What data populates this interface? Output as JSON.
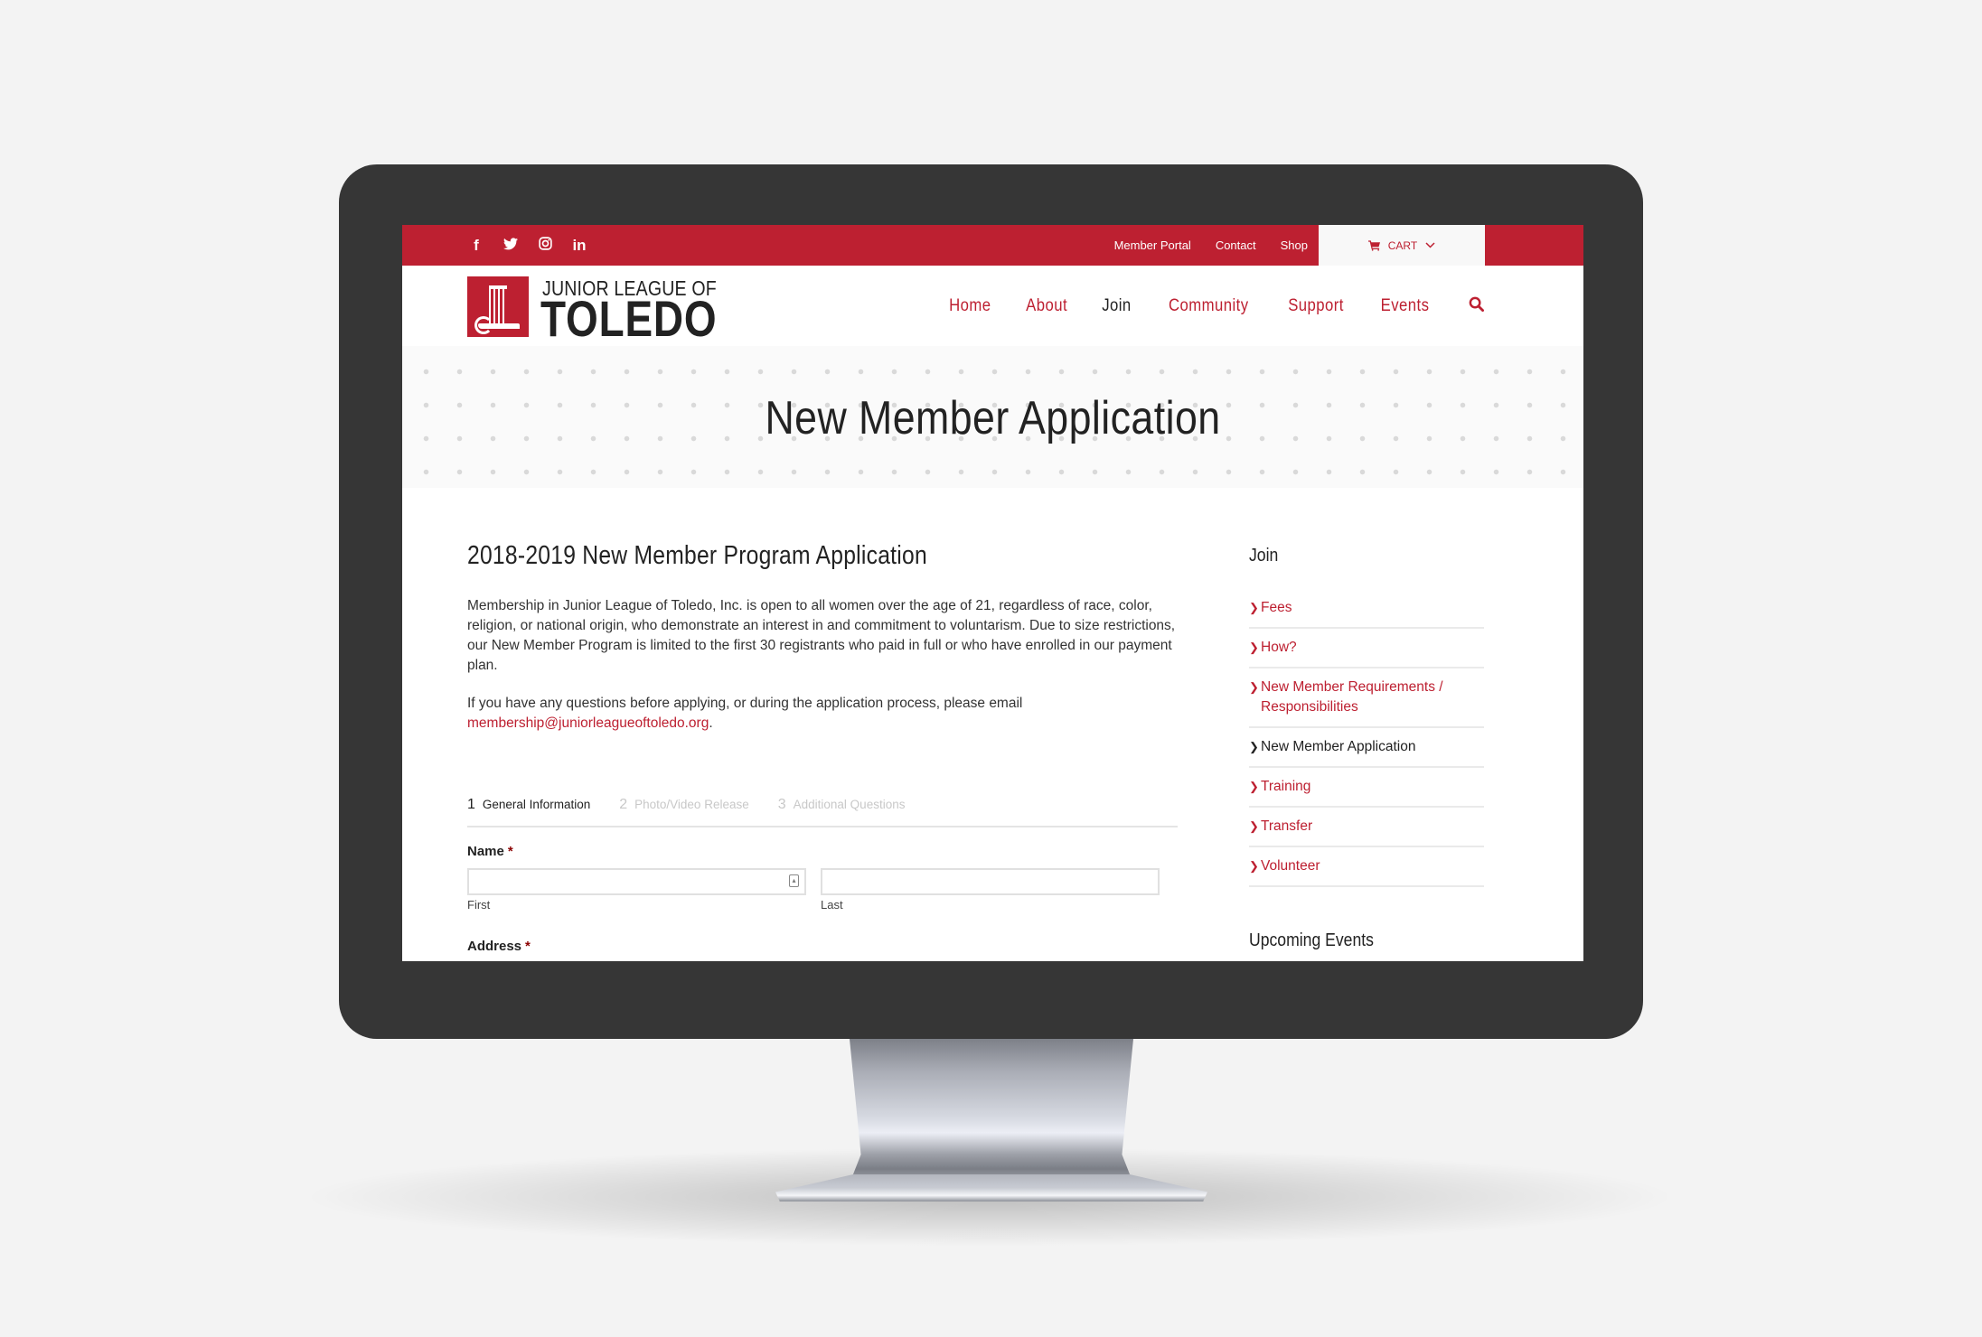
{
  "brand": {
    "accent": "#bd2031",
    "line1": "JUNIOR LEAGUE OF",
    "line2": "TOLEDO"
  },
  "topbar": {
    "social": [
      {
        "name": "facebook",
        "glyph": "f"
      },
      {
        "name": "twitter",
        "glyph": "🐦"
      },
      {
        "name": "instagram",
        "glyph": "◎"
      },
      {
        "name": "linkedin",
        "glyph": "in"
      }
    ],
    "links": [
      "Member Portal",
      "Contact",
      "Shop"
    ],
    "cart": {
      "icon": "cart-icon",
      "label": "CART",
      "caret": "⌄"
    }
  },
  "nav": {
    "items": [
      {
        "label": "Home",
        "active": false
      },
      {
        "label": "About",
        "active": false
      },
      {
        "label": "Join",
        "active": true
      },
      {
        "label": "Community",
        "active": false
      },
      {
        "label": "Support",
        "active": false
      },
      {
        "label": "Events",
        "active": false
      }
    ],
    "search_icon": "search-icon"
  },
  "hero": {
    "title": "New Member Application"
  },
  "main": {
    "heading": "2018-2019 New Member Program Application",
    "paragraph1": "Membership in Junior League of Toledo, Inc. is open to all women over the age of 21, regardless of race, color, religion, or national origin, who demonstrate an interest in and commitment to voluntarism. Due to size restrictions, our New Member Program is limited to the first 30 registrants who paid in full or who have enrolled in our payment plan.",
    "paragraph2": "If you have any questions before applying, or during the application process, please email ",
    "email": "membership@juniorleagueoftoledo.org",
    "email_suffix": ".",
    "steps": [
      {
        "num": "1",
        "label": "General Information",
        "active": true
      },
      {
        "num": "2",
        "label": "Photo/Video Release",
        "active": false
      },
      {
        "num": "3",
        "label": "Additional Questions",
        "active": false
      }
    ],
    "form": {
      "name_label": "Name",
      "required_mark": "*",
      "first": {
        "value": "",
        "placeholder": "",
        "sublabel": "First"
      },
      "last": {
        "value": "",
        "placeholder": "",
        "sublabel": "Last"
      },
      "address_label": "Address"
    }
  },
  "sidebar": {
    "title": "Join",
    "items": [
      {
        "label": "Fees",
        "current": false
      },
      {
        "label": "How?",
        "current": false
      },
      {
        "label": "New Member Requirements / Responsibilities",
        "current": false
      },
      {
        "label": "New Member Application",
        "current": true
      },
      {
        "label": "Training",
        "current": false
      },
      {
        "label": "Transfer",
        "current": false
      },
      {
        "label": "Volunteer",
        "current": false
      }
    ],
    "events_title": "Upcoming Events"
  }
}
